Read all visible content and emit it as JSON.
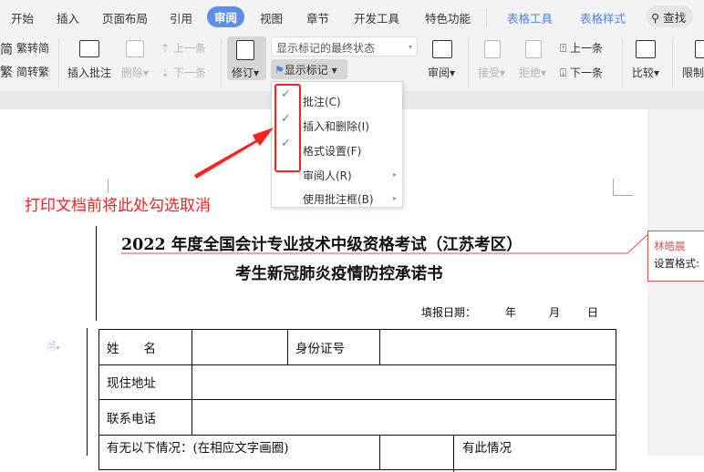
{
  "tabs": [
    "开始",
    "插入",
    "页面布局",
    "引用",
    "审阅",
    "视图",
    "章节",
    "开发工具",
    "特色功能",
    "表格工具",
    "表格样式"
  ],
  "search_label": "查找",
  "ribbon": {
    "trad_to_simp": "繁转简",
    "simp_to_trad": "简转繁",
    "insert_comment": "插入批注",
    "delete": "删除",
    "prev": "上一条",
    "next": "下一条",
    "track_changes": "修订",
    "display_mode": "显示标记的最终状态",
    "show_markup": "显示标记",
    "review": "审阅",
    "accept": "接受",
    "reject": "拒绝",
    "prev2": "上一条",
    "next2": "下一条",
    "compare": "比较",
    "restrict": "限制"
  },
  "menu": {
    "items": [
      {
        "label": "批注(C)",
        "checked": true
      },
      {
        "label": "插入和删除(I)",
        "checked": true
      },
      {
        "label": "格式设置(F)",
        "checked": true
      },
      {
        "label": "审阅人(R)",
        "checked": false,
        "submenu": true
      },
      {
        "label": "使用批注框(B)",
        "checked": false,
        "submenu": true
      }
    ]
  },
  "annotation": "打印文档前将此处勾选取消",
  "document": {
    "title1": "2022 年度全国会计专业技术中级资格考试（江苏考区）",
    "title2": "考生新冠肺炎疫情防控承诺书",
    "date_label": "填报日期：",
    "year": "年",
    "month": "月",
    "day": "日",
    "table": {
      "name": "姓　　名",
      "id": "身份证号",
      "address": "现住地址",
      "phone": "联系电话",
      "conditions": "有无以下情况：(在相应文字画圈)",
      "has_case": "有此情况"
    }
  },
  "comment": {
    "author": "林皓晨",
    "text": "设置格式:"
  },
  "colors": {
    "accent": "#5b8fe8",
    "annotation": "#ff2020",
    "comment": "#d9534f"
  }
}
